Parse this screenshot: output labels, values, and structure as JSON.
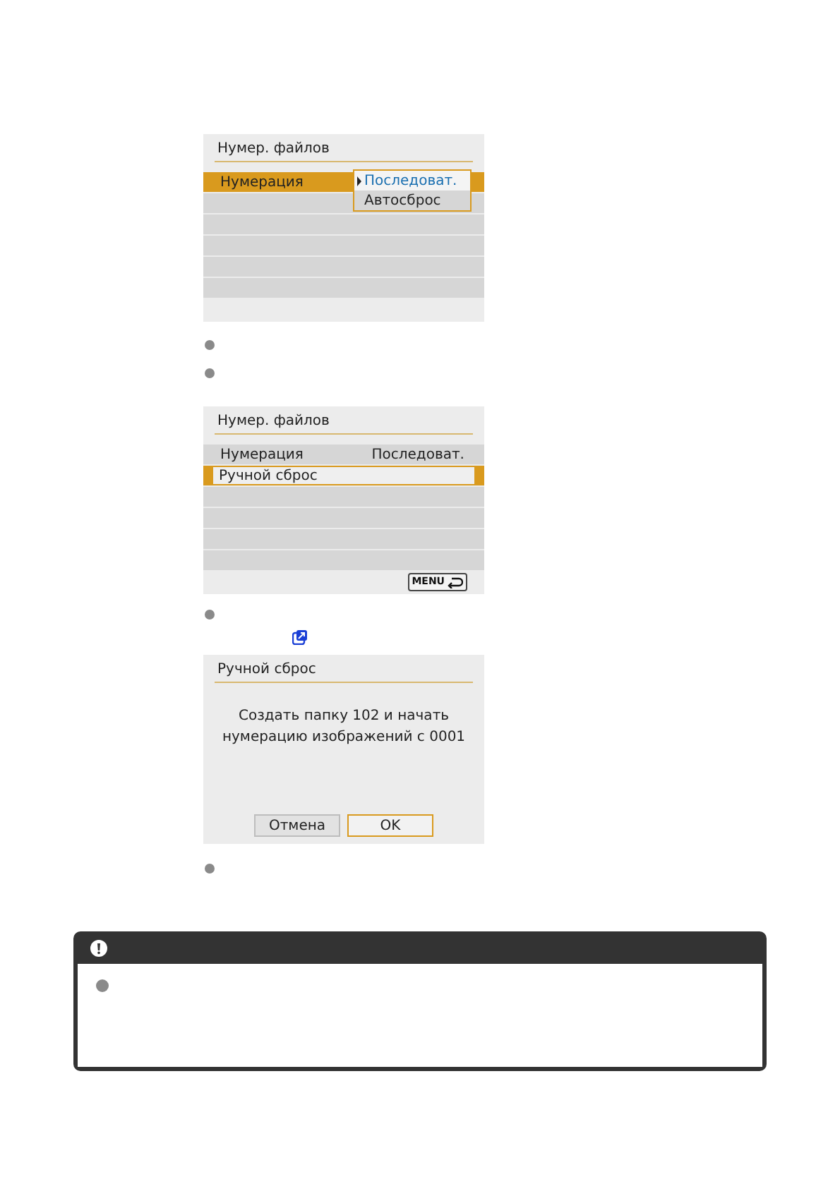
{
  "screens": [
    {
      "kind": "menu",
      "title": "Нумер. файлов",
      "rows": [
        {
          "label": "Нумерация",
          "selected": true
        }
      ],
      "dropdown": {
        "options": [
          {
            "label": "Последоват.",
            "selected": true
          },
          {
            "label": "Автосброс",
            "selected": false
          }
        ]
      }
    },
    {
      "kind": "menu",
      "title": "Нумер. файлов",
      "rows": [
        {
          "label": "Нумерация",
          "value": "Последоват.",
          "selected": false
        },
        {
          "label": "Ручной сброс",
          "selected": true
        }
      ],
      "menu_button": {
        "label": "MENU"
      }
    },
    {
      "kind": "dialog",
      "title": "Ручной сброс",
      "message": [
        "Создать папку 102 и начать",
        "нумерацию изображений с 0001"
      ],
      "buttons": [
        {
          "label": "Отмена",
          "selected": false
        },
        {
          "label": "OK",
          "selected": true
        }
      ]
    }
  ]
}
